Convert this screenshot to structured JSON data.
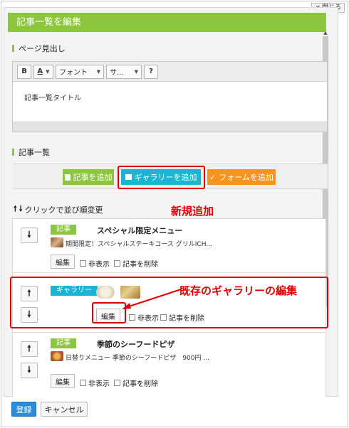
{
  "window": {
    "close_label": "閉じる"
  },
  "dialog": {
    "title": "記事一覧を編集"
  },
  "heading_section": {
    "label": "ページ見出し",
    "toolbar": {
      "bold": "B",
      "font_color": "A",
      "font_family": "フォント",
      "font_size": "サ...",
      "help": "?"
    },
    "content": "記事一覧タイトル"
  },
  "list_section": {
    "label": "記事一覧",
    "add_article": "記事を追加",
    "add_gallery": "ギャラリーを追加",
    "add_form": "フォームを追加",
    "sort_hint": "クリックで並び順変更"
  },
  "annotations": {
    "new_add": "新規追加",
    "edit_gallery": "既存のギャラリーの編集"
  },
  "items": [
    {
      "tag": "記事",
      "tag_color": "#8cc63f",
      "title": "スペシャル限定メニュー",
      "desc": "期間限定！スペシャルステーキコース グリルICH...",
      "edit": "編集",
      "hide": "非表示",
      "delete": "記事を削除"
    },
    {
      "tag": "ギャラリー",
      "tag_color": "#19b5d2",
      "edit": "編集",
      "hide": "非表示",
      "delete": "記事を削除"
    },
    {
      "tag": "記事",
      "tag_color": "#8cc63f",
      "title": "季節のシーフードピザ",
      "desc": "日替りメニュー 季節のシーフードピザ　900円 ...",
      "edit": "編集",
      "hide": "非表示",
      "delete": "記事を削除"
    }
  ],
  "footer": {
    "register": "登録",
    "cancel": "キャンセル"
  },
  "colors": {
    "accent_green": "#8cc63f",
    "gallery_cyan": "#19b5d2",
    "form_orange": "#f7941d",
    "highlight_red": "#e00000",
    "primary_blue": "#2e8bd8"
  }
}
